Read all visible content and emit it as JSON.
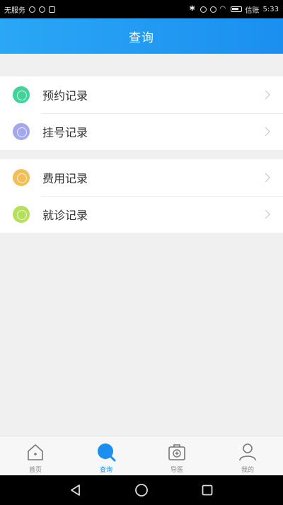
{
  "status_bar": {
    "carrier": "无服务",
    "time": "5:33",
    "right_text": "信账"
  },
  "header": {
    "title": "查询"
  },
  "records": {
    "group1": [
      {
        "label": "预约记录",
        "color": "#3ed49a",
        "icon": "appointment-icon"
      },
      {
        "label": "挂号记录",
        "color": "#a3a8ec",
        "icon": "registration-icon"
      }
    ],
    "group2": [
      {
        "label": "费用记录",
        "color": "#f2bf56",
        "icon": "expense-icon"
      },
      {
        "label": "就诊记录",
        "color": "#b5e05b",
        "icon": "visit-icon"
      }
    ]
  },
  "tabs": [
    {
      "label": "首页",
      "icon": "home-icon",
      "active": false
    },
    {
      "label": "查询",
      "icon": "search-icon",
      "active": true
    },
    {
      "label": "导医",
      "icon": "medical-kit-icon",
      "active": false
    },
    {
      "label": "我的",
      "icon": "user-icon",
      "active": false
    }
  ],
  "colors": {
    "accent": "#1b8ff0",
    "header_start": "#2aa7f5"
  }
}
